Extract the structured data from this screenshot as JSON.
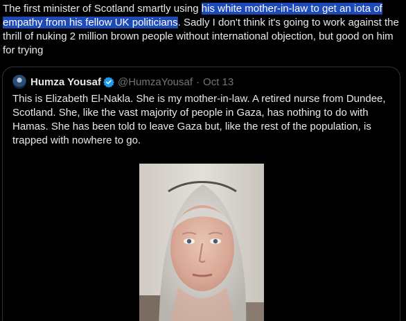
{
  "post": {
    "text_before": "The first minister of Scotland smartly using ",
    "text_highlighted": "his white mother-in-law to get an iota of empathy from his fellow UK politicians",
    "text_after": ". Sadly I don't think it's going to work against the thrill of nuking 2 million brown people without international objection, but good on him for trying"
  },
  "quote": {
    "display_name": "Humza Yousaf",
    "handle": "@HumzaYousaf",
    "separator": "·",
    "date": "Oct 13",
    "text": "This is Elizabeth El-Nakla. She is my mother-in-law. A retired nurse from Dundee, Scotland. She, like the vast majority of people in Gaza, has nothing to do with Hamas. She has been told to leave Gaza but, like the rest of the population, is trapped with nowhere to go.",
    "verified_icon": "verified-badge-icon",
    "media": "video-thumbnail"
  },
  "colors": {
    "background": "#000000",
    "text": "#e7e9ea",
    "muted": "#71767b",
    "highlight": "#1d4ab8",
    "verified": "#1d9bf0",
    "border": "#2f3336"
  }
}
